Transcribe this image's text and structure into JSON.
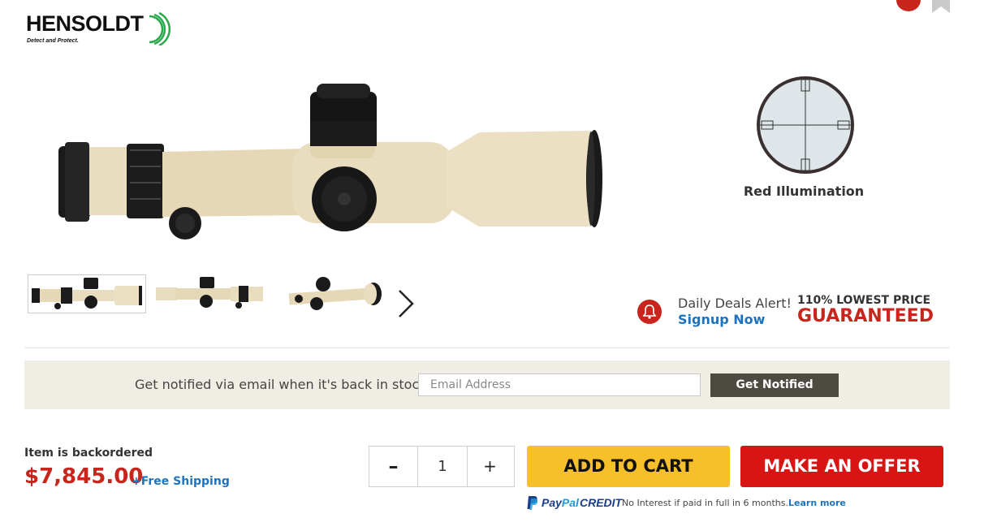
{
  "brand": {
    "name": "HENSOLDT",
    "tagline": "Detect and Protect."
  },
  "gallery": {
    "reticle_label": "Red Illumination",
    "thumbnails": [
      "thumbnail-1",
      "thumbnail-2",
      "thumbnail-3"
    ],
    "next_icon": "chevron-right-icon"
  },
  "deals": {
    "title": "Daily Deals Alert!",
    "link": "Signup Now",
    "guarantee_top": "110% LOWEST PRICE",
    "guarantee_bottom": "GUARANTEED"
  },
  "notify": {
    "text": "Get notified via email when it's back in stock.",
    "email_placeholder": "Email Address",
    "button": "Get Notified"
  },
  "purchase": {
    "stock_status": "Item is backordered",
    "price": "$7,845.00",
    "shipping": "+Free Shipping",
    "qty_minus": "–",
    "qty_value": "1",
    "qty_plus": "+",
    "add_to_cart": "ADD TO CART",
    "make_offer": "MAKE AN OFFER"
  },
  "paypal": {
    "word_pay": "Pay",
    "word_pal": "Pal",
    "credit": "CREDIT",
    "note": "No Interest if paid in full in 6 months.",
    "learn_more": "Learn more"
  },
  "colors": {
    "accent_red": "#c8261d",
    "link_blue": "#1e73be",
    "cart_yellow": "#f7c02b",
    "offer_red": "#d71515",
    "scope_tan": "#e9ddbf"
  }
}
